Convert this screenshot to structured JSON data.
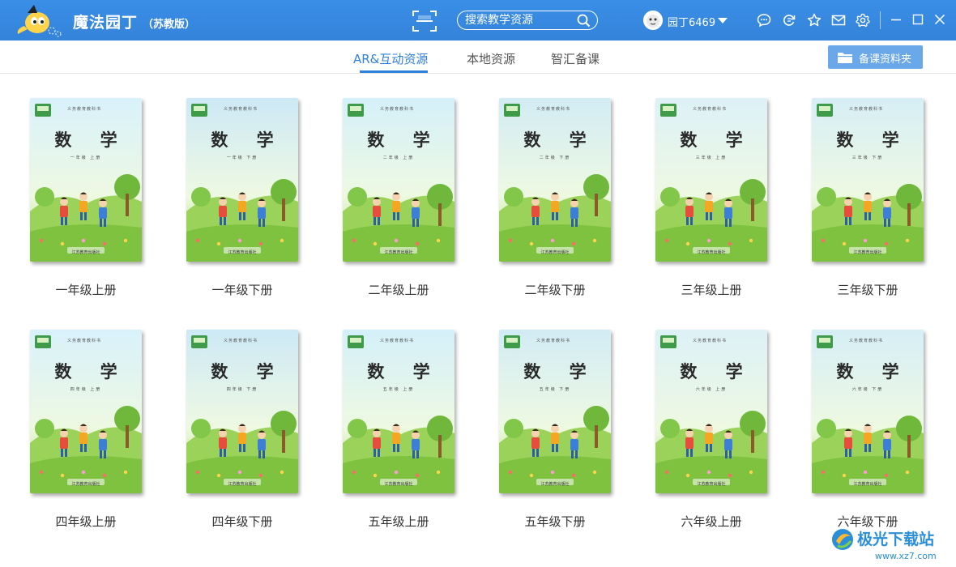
{
  "app": {
    "title": "魔法园丁",
    "edition": "（苏教版）"
  },
  "search": {
    "placeholder": "搜索教学资源"
  },
  "user": {
    "name": "园丁6469"
  },
  "toolbar_icons": [
    "chat-icon",
    "refresh-icon",
    "star-icon",
    "mail-icon",
    "gear-icon"
  ],
  "tabs": [
    {
      "label": "AR&互动资源",
      "active": true
    },
    {
      "label": "本地资源",
      "active": false
    },
    {
      "label": "智汇备课",
      "active": false
    }
  ],
  "folder_button": {
    "label": "备课资料夹"
  },
  "cover": {
    "title": "数 学",
    "series": "义务教育教科书",
    "publisher": "江苏教育出版社"
  },
  "books": [
    {
      "label": "一年级上册",
      "grade": "一年级 上册"
    },
    {
      "label": "一年级下册",
      "grade": "一年级 下册"
    },
    {
      "label": "二年级上册",
      "grade": "二年级 上册"
    },
    {
      "label": "二年级下册",
      "grade": "二年级 下册"
    },
    {
      "label": "三年级上册",
      "grade": "三年级 上册"
    },
    {
      "label": "三年级下册",
      "grade": "三年级 下册"
    },
    {
      "label": "四年级上册",
      "grade": "四年级 上册"
    },
    {
      "label": "四年级下册",
      "grade": "四年级 下册"
    },
    {
      "label": "五年级上册",
      "grade": "五年级 上册"
    },
    {
      "label": "五年级下册",
      "grade": "五年级 下册"
    },
    {
      "label": "六年级上册",
      "grade": "六年级 上册"
    },
    {
      "label": "六年级下册",
      "grade": "六年级 下册"
    }
  ],
  "watermark": {
    "name": "极光下载站",
    "url": "www.xz7.com"
  },
  "colors": {
    "titlebar": "#3483da",
    "accent": "#2f82db",
    "folder_button": "#6ba8ea",
    "cover_sky": "#cfeefa",
    "cover_grass": "#8fcf4a"
  }
}
